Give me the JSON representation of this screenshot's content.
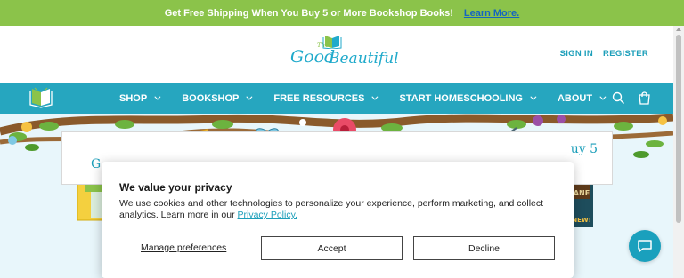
{
  "promo": {
    "text": "Get Free Shipping When You Buy 5 or More Bookshop Books!",
    "link": "Learn More."
  },
  "header": {
    "logo": {
      "the": "The",
      "good": "Good",
      "and": "and",
      "beautiful": "Beautiful"
    },
    "sign_in": "SIGN IN",
    "register": "REGISTER"
  },
  "nav": {
    "items": [
      {
        "label": "SHOP"
      },
      {
        "label": "BOOKSHOP"
      },
      {
        "label": "FREE RESOURCES"
      },
      {
        "label": "START HOMESCHOOLING"
      },
      {
        "label": "ABOUT"
      }
    ],
    "icons": [
      "search-icon",
      "cart-icon"
    ]
  },
  "hero": {
    "card_left_text": "G",
    "card_right_text": "uy 5",
    "book_badge": "NEW!",
    "book_title_fragment": "ANE"
  },
  "privacy": {
    "title": "We value your privacy",
    "body": "We use cookies and other technologies to personalize your experience, perform marketing, and collect analytics. Learn more in our",
    "policy_link": "Privacy Policy.",
    "manage": "Manage preferences",
    "accept": "Accept",
    "decline": "Decline"
  },
  "colors": {
    "promo_bg": "#8bc34a",
    "nav_bg": "#26a6bf",
    "brand_teal": "#1d9fba",
    "chat_bg": "#1aa0bd"
  }
}
